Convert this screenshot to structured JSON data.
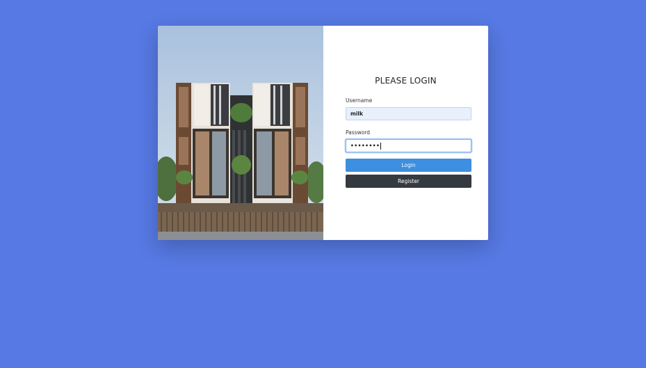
{
  "colors": {
    "background": "#5679e3",
    "login_button": "#3d8fdf",
    "register_button": "#343a40"
  },
  "form": {
    "title": "PLEASE LOGIN",
    "username_label": "Username",
    "username_value": "milk",
    "password_label": "Password",
    "password_value": "••••••••",
    "login_label": "Login",
    "register_label": "Register"
  }
}
